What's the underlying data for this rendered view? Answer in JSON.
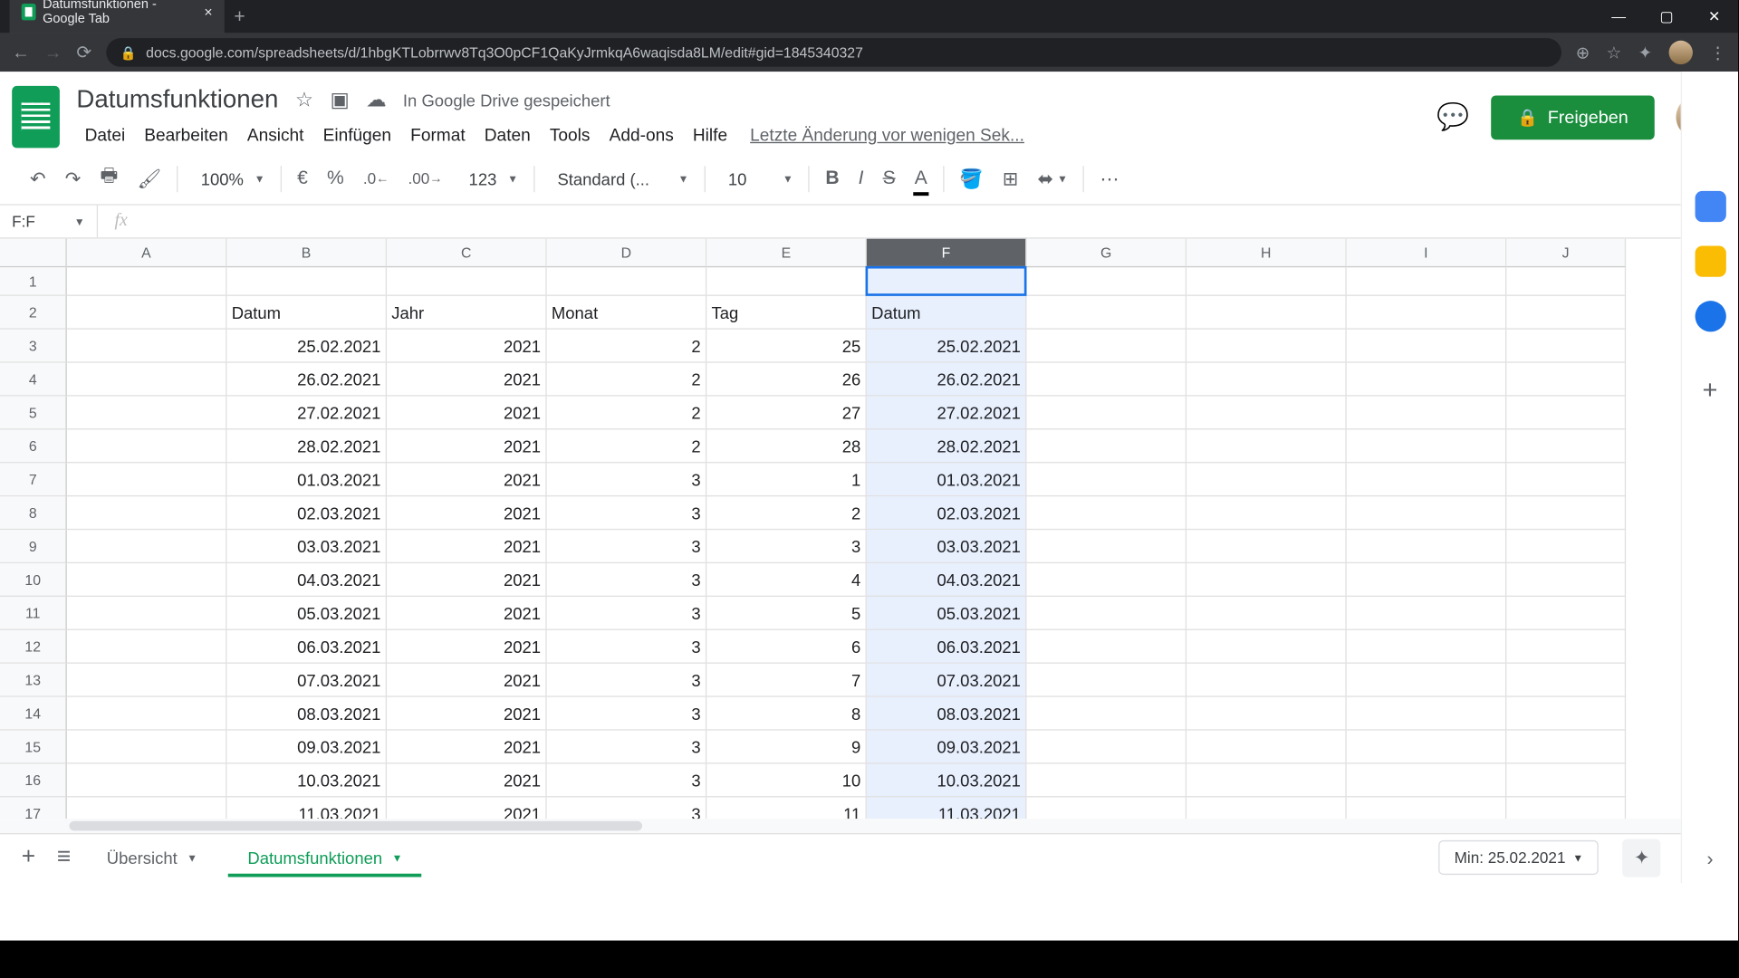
{
  "browser": {
    "tab_title": "Datumsfunktionen - Google Tab",
    "url": "docs.google.com/spreadsheets/d/1hbgKTLobrrwv8Tq3O0pCF1QaKyJrmkqA6waqisda8LM/edit#gid=1845340327"
  },
  "doc": {
    "title": "Datumsfunktionen",
    "drive_status": "In Google Drive gespeichert",
    "last_edit": "Letzte Änderung vor wenigen Sek...",
    "share_label": "Freigeben"
  },
  "menus": [
    "Datei",
    "Bearbeiten",
    "Ansicht",
    "Einfügen",
    "Format",
    "Daten",
    "Tools",
    "Add-ons",
    "Hilfe"
  ],
  "toolbar": {
    "zoom": "100%",
    "currency": "€",
    "percent": "%",
    "dec_less": ".0",
    "dec_more": ".00",
    "num_format": "123",
    "font": "Standard (...",
    "font_size": "10"
  },
  "name_box": "F:F",
  "columns": [
    "A",
    "B",
    "C",
    "D",
    "E",
    "F",
    "G",
    "H",
    "I",
    "J"
  ],
  "selected_col_index": 5,
  "headers_row": {
    "B": "Datum",
    "C": "Jahr",
    "D": "Monat",
    "E": "Tag",
    "F": "Datum"
  },
  "rows": [
    {
      "n": 3,
      "B": "25.02.2021",
      "C": "2021",
      "D": "2",
      "E": "25",
      "F": "25.02.2021"
    },
    {
      "n": 4,
      "B": "26.02.2021",
      "C": "2021",
      "D": "2",
      "E": "26",
      "F": "26.02.2021"
    },
    {
      "n": 5,
      "B": "27.02.2021",
      "C": "2021",
      "D": "2",
      "E": "27",
      "F": "27.02.2021"
    },
    {
      "n": 6,
      "B": "28.02.2021",
      "C": "2021",
      "D": "2",
      "E": "28",
      "F": "28.02.2021"
    },
    {
      "n": 7,
      "B": "01.03.2021",
      "C": "2021",
      "D": "3",
      "E": "1",
      "F": "01.03.2021"
    },
    {
      "n": 8,
      "B": "02.03.2021",
      "C": "2021",
      "D": "3",
      "E": "2",
      "F": "02.03.2021"
    },
    {
      "n": 9,
      "B": "03.03.2021",
      "C": "2021",
      "D": "3",
      "E": "3",
      "F": "03.03.2021"
    },
    {
      "n": 10,
      "B": "04.03.2021",
      "C": "2021",
      "D": "3",
      "E": "4",
      "F": "04.03.2021"
    },
    {
      "n": 11,
      "B": "05.03.2021",
      "C": "2021",
      "D": "3",
      "E": "5",
      "F": "05.03.2021"
    },
    {
      "n": 12,
      "B": "06.03.2021",
      "C": "2021",
      "D": "3",
      "E": "6",
      "F": "06.03.2021"
    },
    {
      "n": 13,
      "B": "07.03.2021",
      "C": "2021",
      "D": "3",
      "E": "7",
      "F": "07.03.2021"
    },
    {
      "n": 14,
      "B": "08.03.2021",
      "C": "2021",
      "D": "3",
      "E": "8",
      "F": "08.03.2021"
    },
    {
      "n": 15,
      "B": "09.03.2021",
      "C": "2021",
      "D": "3",
      "E": "9",
      "F": "09.03.2021"
    },
    {
      "n": 16,
      "B": "10.03.2021",
      "C": "2021",
      "D": "3",
      "E": "10",
      "F": "10.03.2021"
    },
    {
      "n": 17,
      "B": "11.03.2021",
      "C": "2021",
      "D": "3",
      "E": "11",
      "F": "11.03.2021"
    }
  ],
  "sheets": {
    "tab1": "Übersicht",
    "tab2": "Datumsfunktionen",
    "explore": "Min: 25.02.2021"
  }
}
